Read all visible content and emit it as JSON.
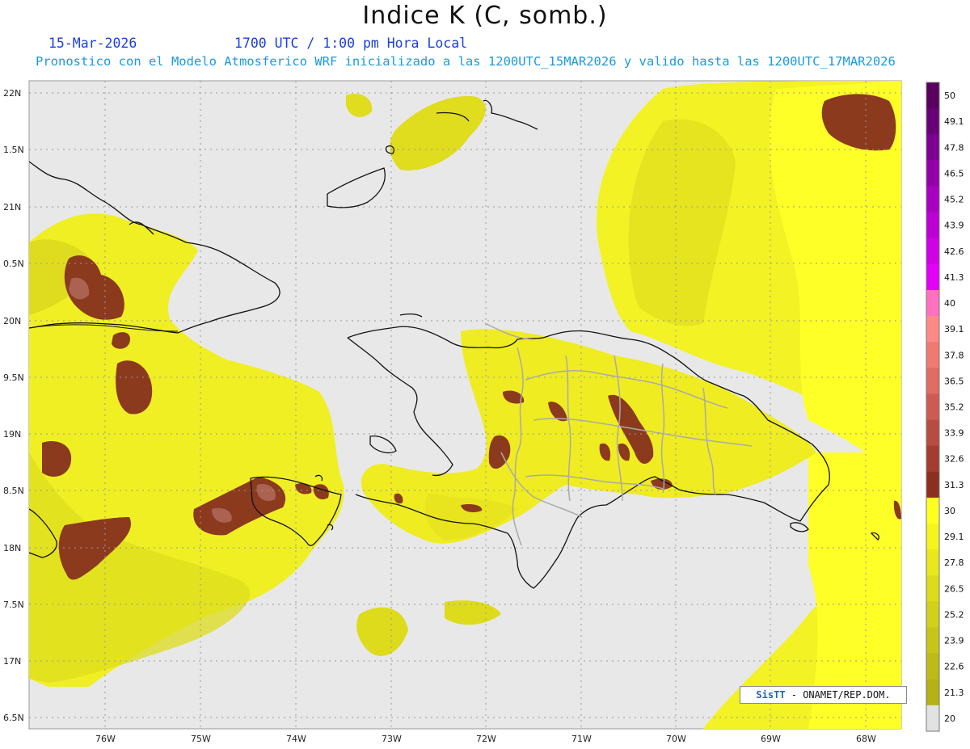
{
  "header": {
    "title": "Indice K (C, somb.)",
    "date": "15-Mar-2026",
    "time": "1700 UTC / 1:00 pm Hora Local",
    "forecast": "Pronostico con el Modelo Atmosferico WRF inicializado a las 1200UTC_15MAR2026 y valido hasta las  1200UTC_17MAR2026"
  },
  "map": {
    "lat_labels": [
      "22N",
      "1.5N",
      "21N",
      "0.5N",
      "20N",
      "9.5N",
      "19N",
      "8.5N",
      "18N",
      "7.5N",
      "17N",
      "6.5N"
    ],
    "lon_labels": [
      "76W",
      "75W",
      "74W",
      "73W",
      "72W",
      "71W",
      "70W",
      "69W",
      "68W"
    ],
    "colors": {
      "background": "#e8e8e8",
      "field_20": "#c9c21a",
      "field_24": "#dede1c",
      "field_28": "#f2f224",
      "field_30": "#ffff28",
      "high_30": "#8b3a1e",
      "high_32": "#b05a4a"
    }
  },
  "colorbar": {
    "labels": [
      "50",
      "49.1",
      "47.8",
      "46.5",
      "45.2",
      "43.9",
      "42.6",
      "41.3",
      "40",
      "39.1",
      "37.8",
      "36.5",
      "35.2",
      "33.9",
      "32.6",
      "31.3",
      "30",
      "29.1",
      "27.8",
      "26.5",
      "25.2",
      "23.9",
      "22.6",
      "21.3",
      "20"
    ],
    "colors": [
      "#5a0060",
      "#6a0078",
      "#7e0090",
      "#9400a8",
      "#a800c0",
      "#bc00d4",
      "#d000e6",
      "#e400f6",
      "#ff70c0",
      "#ff8888",
      "#f07a70",
      "#e06c62",
      "#cc5c52",
      "#b84c42",
      "#a43c30",
      "#8b3020",
      "#ffff20",
      "#f4f41e",
      "#e8e81c",
      "#dcdc1a",
      "#d2d01a",
      "#c8c418",
      "#bebb16",
      "#b4b214",
      "#e2e2e2"
    ]
  },
  "credit": {
    "logo": "SisTT",
    "text": " - ONAMET/REP.DOM."
  }
}
